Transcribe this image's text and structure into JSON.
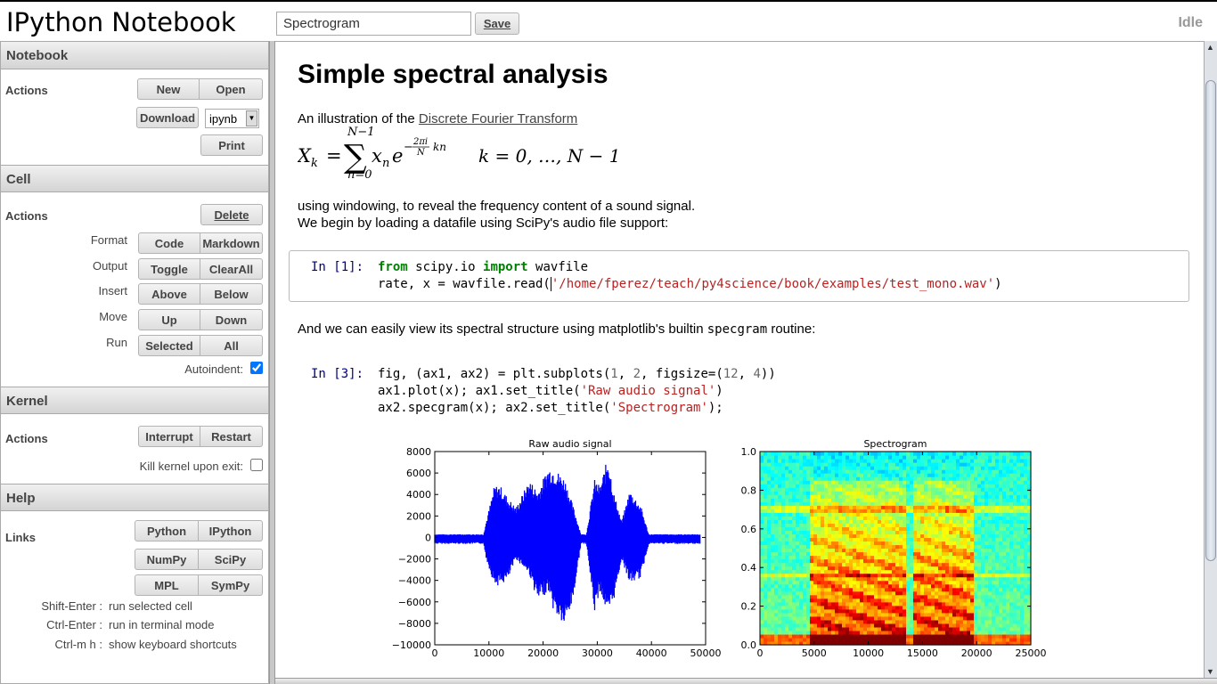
{
  "header": {
    "app_title": "IPython Notebook",
    "notebook_name": "Spectrogram",
    "save_label": "Save",
    "status": "Idle"
  },
  "sidebar": {
    "notebook": {
      "title": "Notebook",
      "actions_label": "Actions",
      "new": "New",
      "open": "Open",
      "download": "Download",
      "format_select": "ipynb",
      "print": "Print"
    },
    "cell": {
      "title": "Cell",
      "actions_label": "Actions",
      "delete": "Delete",
      "rows": [
        {
          "label": "Format",
          "a": "Code",
          "b": "Markdown"
        },
        {
          "label": "Output",
          "a": "Toggle",
          "b": "ClearAll"
        },
        {
          "label": "Insert",
          "a": "Above",
          "b": "Below"
        },
        {
          "label": "Move",
          "a": "Up",
          "b": "Down"
        },
        {
          "label": "Run",
          "a": "Selected",
          "b": "All"
        }
      ],
      "autoindent_label": "Autoindent:",
      "autoindent_checked": true
    },
    "kernel": {
      "title": "Kernel",
      "actions_label": "Actions",
      "interrupt": "Interrupt",
      "restart": "Restart",
      "kill_label": "Kill kernel upon exit:",
      "kill_checked": false
    },
    "help": {
      "title": "Help",
      "links_label": "Links",
      "links": [
        "Python",
        "IPython",
        "NumPy",
        "SciPy",
        "MPL",
        "SymPy"
      ],
      "shortcuts": [
        {
          "key": "Shift-Enter :",
          "desc": "run selected cell"
        },
        {
          "key": "Ctrl-Enter :",
          "desc": "run in terminal mode"
        },
        {
          "key": "Ctrl-m h :",
          "desc": "show keyboard shortcuts"
        }
      ]
    }
  },
  "notebook": {
    "heading": "Simple spectral analysis",
    "intro_prefix": "An illustration of the ",
    "intro_link": "Discrete Fourier Transform",
    "formula_left": "X_k = Σ_{n=0}^{N−1} x_n e^{−(2πi/N) kn}",
    "formula_right": "k = 0, …, N − 1",
    "para1": "using windowing, to reveal the frequency content of a sound signal.",
    "para2": "We begin by loading a datafile using SciPy's audio file support:",
    "cell1_prompt": "In [1]:",
    "cell1_line2_prefix": "rate, x = wavfile.read(",
    "cell1_path": "'/home/fperez/teach/py4science/book/examples/test_mono.wav'",
    "para3_prefix": "And we can easily view its spectral structure using matplotlib's builtin ",
    "para3_code": "specgram",
    "para3_suffix": " routine:",
    "cell3_prompt": "In [3]:"
  },
  "chart_data": [
    {
      "type": "line",
      "title": "Raw audio signal",
      "xlim": [
        0,
        50000
      ],
      "ylim": [
        -10000,
        8000
      ],
      "xticks": [
        "0",
        "10000",
        "20000",
        "30000",
        "40000",
        "50000"
      ],
      "yticks": [
        "8000",
        "6000",
        "4000",
        "2000",
        "0",
        "−2000",
        "−4000",
        "−6000",
        "−8000",
        "−10000"
      ],
      "envelope": {
        "x": [
          0,
          9000,
          9500,
          11000,
          12000,
          13500,
          15000,
          17500,
          19000,
          21000,
          22000,
          24000,
          25500,
          27000,
          28000,
          29500,
          30500,
          32000,
          33000,
          34500,
          36000,
          38000,
          39500,
          40000,
          49000
        ],
        "upper": [
          300,
          300,
          1500,
          4800,
          4900,
          3700,
          2800,
          5400,
          4300,
          6600,
          6500,
          5500,
          3000,
          300,
          300,
          5400,
          4800,
          7600,
          4300,
          1500,
          4400,
          3000,
          300,
          300,
          300
        ],
        "lower": [
          -600,
          -600,
          -2000,
          -4400,
          -4500,
          -4000,
          -2000,
          -3500,
          -6000,
          -5000,
          -7000,
          -8400,
          -6000,
          -600,
          -600,
          -7000,
          -5000,
          -7500,
          -6000,
          -2000,
          -4300,
          -3800,
          -600,
          -600,
          -600
        ]
      },
      "color": "#0000ff"
    },
    {
      "type": "heatmap",
      "title": "Spectrogram",
      "xlim": [
        0,
        25000
      ],
      "ylim": [
        0,
        1.0
      ],
      "xticks": [
        "0",
        "5000",
        "10000",
        "15000",
        "20000",
        "25000"
      ],
      "yticks": [
        "1.0",
        "0.8",
        "0.6",
        "0.4",
        "0.2",
        "0.0"
      ],
      "colormap": "jet",
      "background_level": "green-cyan",
      "speech_regions": [
        [
          4700,
          13500
        ],
        [
          14000,
          17000
        ],
        [
          17200,
          19800
        ]
      ],
      "horizontal_bands": [
        0.355,
        0.705
      ]
    }
  ]
}
